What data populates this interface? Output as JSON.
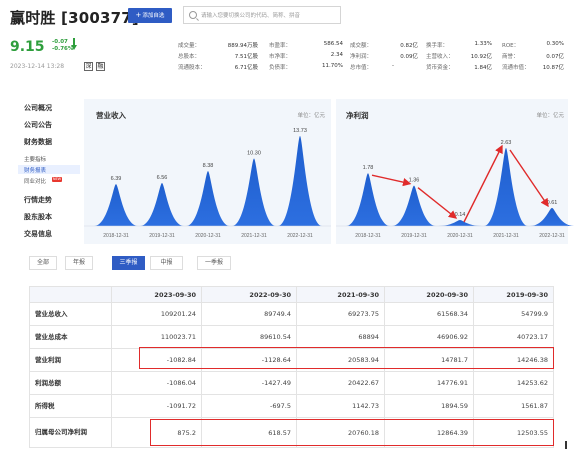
{
  "header": {
    "stock_title": "赢时胜 [300377]",
    "add_button_label": "添加自选",
    "search_placeholder": "请输入您要切换公司的代码、简称、拼音",
    "price": "9.15",
    "change_abs": "-0.07",
    "change_pct": "-0.76%",
    "timestamp": "2023-12-14 13:28",
    "tags": [
      "深",
      "融"
    ],
    "stats": [
      {
        "label": "成交量：",
        "value": "889.94万股"
      },
      {
        "label": "总股本：",
        "value": "7.51亿股"
      },
      {
        "label": "流通股本：",
        "value": "6.71亿股"
      },
      {
        "label": "市盈率：",
        "value": "586.54"
      },
      {
        "label": "市净率：",
        "value": "2.34"
      },
      {
        "label": "负债率：",
        "value": "11.70%"
      },
      {
        "label": "成交额：",
        "value": "0.82亿"
      },
      {
        "label": "净利润：",
        "value": "0.09亿"
      },
      {
        "label": "总市值：",
        "value": "-"
      },
      {
        "label": "换手率：",
        "value": "1.33%"
      },
      {
        "label": "主营收入：",
        "value": "10.92亿"
      },
      {
        "label": "货币资金：",
        "value": "1.84亿"
      },
      {
        "label": "ROE：",
        "value": "0.30%"
      },
      {
        "label": "商誉：",
        "value": "0.07亿"
      },
      {
        "label": "流通市值：",
        "value": "10.87亿"
      }
    ]
  },
  "nav": {
    "items": [
      "公司概况",
      "公司公告",
      "财务数据",
      "行情走势",
      "股东股本",
      "交易信息"
    ],
    "sub_items": [
      "主要指标",
      "财务报表",
      "同业对比"
    ],
    "new_badge": "NEW"
  },
  "charts": {
    "revenue": {
      "title": "营业收入",
      "unit": "单位：亿元"
    },
    "profit": {
      "title": "净利润",
      "unit": "单位：亿元"
    }
  },
  "chart_data": [
    {
      "type": "area",
      "title": "营业收入",
      "x": [
        "2018-12-31",
        "2019-12-31",
        "2020-12-31",
        "2021-12-31",
        "2022-12-31"
      ],
      "values": [
        6.39,
        6.56,
        8.38,
        10.3,
        13.73
      ],
      "labels": [
        "6.39",
        "6.56",
        "8.38",
        "10.30",
        "13.73"
      ],
      "color": "#1f5fcf"
    },
    {
      "type": "area",
      "title": "净利润",
      "x": [
        "2018-12-31",
        "2019-12-31",
        "2020-12-31",
        "2021-12-31",
        "2022-12-31"
      ],
      "values": [
        1.78,
        1.36,
        0.14,
        2.63,
        0.61
      ],
      "labels": [
        "1.78",
        "1.36",
        "0.14",
        "2.63",
        "0.61"
      ],
      "color": "#1f5fcf",
      "annotation_color": "#e02b2b"
    }
  ],
  "tabs": [
    "全部",
    "年报",
    "三季报",
    "中报",
    "一季报"
  ],
  "active_tab": 2,
  "table": {
    "columns": [
      "",
      "2023-09-30",
      "2022-09-30",
      "2021-09-30",
      "2020-09-30",
      "2019-09-30"
    ],
    "rows": [
      {
        "label": "营业总收入",
        "values": [
          "109201.24",
          "89749.4",
          "69273.75",
          "61568.34",
          "54799.9"
        ]
      },
      {
        "label": "营业总成本",
        "values": [
          "110023.71",
          "89610.54",
          "68894",
          "46906.92",
          "40723.17"
        ]
      },
      {
        "label": "营业利润",
        "values": [
          "-1082.84",
          "-1128.64",
          "20583.94",
          "14781.7",
          "14246.38"
        ]
      },
      {
        "label": "利润总额",
        "values": [
          "-1086.04",
          "-1427.49",
          "20422.67",
          "14776.91",
          "14253.62"
        ]
      },
      {
        "label": "所得税",
        "values": [
          "-1091.72",
          "-697.5",
          "1142.73",
          "1894.59",
          "1561.87"
        ]
      },
      {
        "label": "归属母公司净利润",
        "values": [
          "875.2",
          "618.57",
          "20760.18",
          "12864.39",
          "12503.55"
        ]
      }
    ],
    "highlight_color": "#e02b2b"
  }
}
